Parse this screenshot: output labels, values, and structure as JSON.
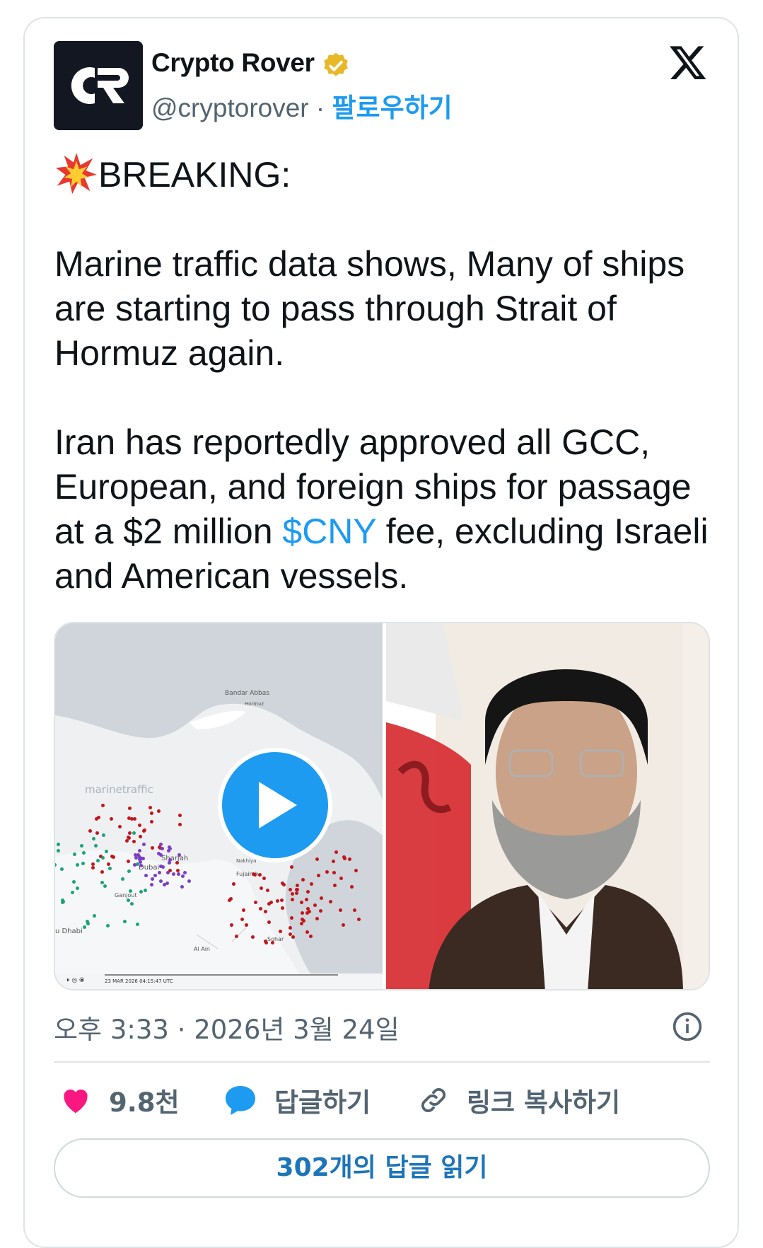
{
  "author": {
    "name": "Crypto Rover",
    "handle": "@cryptorover",
    "separator": "·",
    "follow_label": "팔로우하기",
    "avatar_text": "CR"
  },
  "tweet": {
    "headline": "BREAKING:",
    "para1": "Marine traffic data shows, Many of ships are starting to pass through Strait of Hormuz again.",
    "para2_before": "Iran has reportedly approved all GCC, European, and foreign ships for passage at a $2 million ",
    "cashtag": "$CNY",
    "para2_after": " fee, excluding Israeli and American vessels."
  },
  "media": {
    "map_labels": {
      "bandar_abbas": "Bandar Abbas",
      "dubai": "Dubai",
      "sharjah": "Sharjah",
      "ganjout": "Ganjout",
      "abu_dhabi": "u Dhabi",
      "fujairah": "Fujairah",
      "sohar": "Sohar",
      "al_ain": "Al Ain",
      "hormuz": "Hormuz",
      "nakhiya": "Nakhiya"
    },
    "watermark": "marinetraffic",
    "timestamp": "23 MAR 2026 04:15:47 UTC"
  },
  "meta": {
    "time": "오후 3:33 · 2026년 3월 24일"
  },
  "actions": {
    "likes": "9.8천",
    "reply_label": "답글하기",
    "copy_link_label": "링크 복사하기"
  },
  "read_replies_label": "302개의 답글 읽기",
  "colors": {
    "accent": "#1d9bf0",
    "like": "#f91880",
    "text": "#0f1419",
    "muted": "#536471"
  }
}
